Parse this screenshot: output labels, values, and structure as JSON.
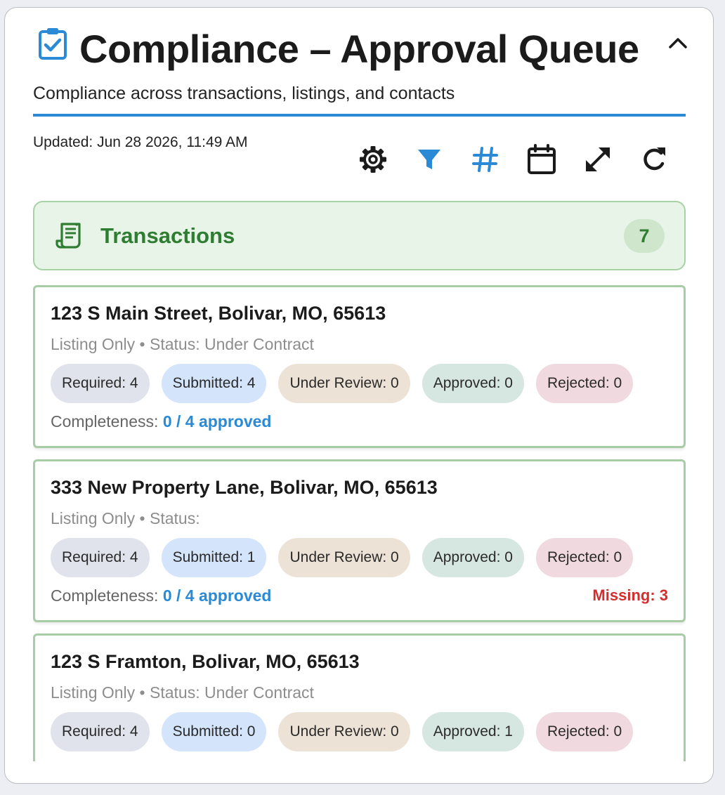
{
  "header": {
    "title": "Compliance – Approval Queue",
    "subtitle": "Compliance across transactions, listings, and contacts",
    "title_icon": "clipboard-check-icon",
    "collapse_icon": "chevron-up-icon"
  },
  "updated": "Updated: Jun 28 2026, 11:49 AM",
  "toolbar": {
    "icons": [
      "gear-icon",
      "filter-icon",
      "hash-icon",
      "calendar-icon",
      "expand-icon",
      "refresh-icon"
    ]
  },
  "section": {
    "title": "Transactions",
    "count": "7",
    "icon": "receipt-icon"
  },
  "cards": [
    {
      "address": "123 S Main Street, Bolivar, MO, 65613",
      "meta": "Listing Only • Status: Under Contract",
      "pills": {
        "required": "Required: 4",
        "submitted": "Submitted: 4",
        "review": "Under Review: 0",
        "approved": "Approved: 0",
        "rejected": "Rejected: 0"
      },
      "completeness_label": "Completeness: ",
      "completeness_value": "0 / 4 approved",
      "missing": ""
    },
    {
      "address": "333 New Property Lane, Bolivar, MO, 65613",
      "meta": "Listing Only • Status:",
      "pills": {
        "required": "Required: 4",
        "submitted": "Submitted: 1",
        "review": "Under Review: 0",
        "approved": "Approved: 0",
        "rejected": "Rejected: 0"
      },
      "completeness_label": "Completeness: ",
      "completeness_value": "0 / 4 approved",
      "missing": "Missing: 3"
    },
    {
      "address": "123 S Framton, Bolivar, MO, 65613",
      "meta": "Listing Only • Status: Under Contract",
      "pills": {
        "required": "Required: 4",
        "submitted": "Submitted: 0",
        "review": "Under Review: 0",
        "approved": "Approved: 1",
        "rejected": "Rejected: 0"
      },
      "completeness_label": "",
      "completeness_value": "",
      "missing": ""
    }
  ],
  "colors": {
    "accent": "#2a8ad5",
    "section_green": "#2e7d32",
    "missing_red": "#d32f2f"
  }
}
